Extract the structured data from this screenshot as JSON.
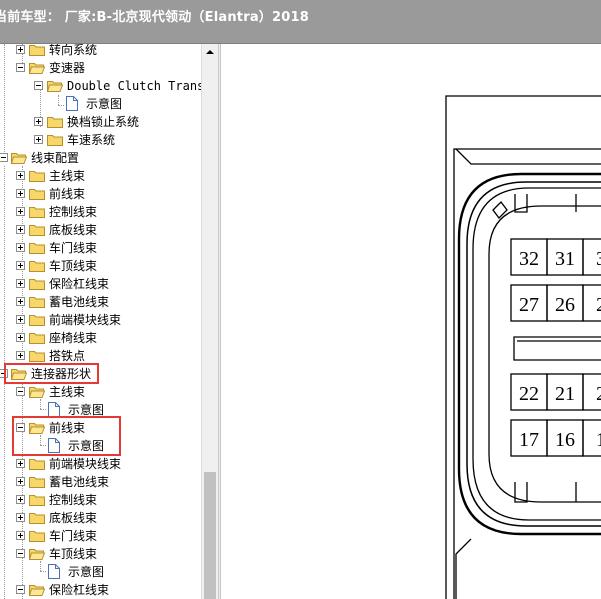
{
  "window": {
    "title": "当前车型：  厂家:B-北京现代领动（Elantra）2018"
  },
  "tree": {
    "items": [
      {
        "label": "转向系统",
        "toggle": "plus",
        "icon": "folder"
      },
      {
        "label": "变速器",
        "toggle": "minus",
        "icon": "folder-open"
      },
      {
        "label": "Double Clutch Transmission",
        "toggle": "minus",
        "icon": "folder-open"
      },
      {
        "label": "示意图",
        "toggle": "",
        "icon": "doc"
      },
      {
        "label": "换档锁止系统",
        "toggle": "plus",
        "icon": "folder"
      },
      {
        "label": "车速系统",
        "toggle": "plus",
        "icon": "folder"
      },
      {
        "label": "线束配置",
        "toggle": "minus",
        "icon": "folder-open"
      },
      {
        "label": "主线束",
        "toggle": "plus",
        "icon": "folder"
      },
      {
        "label": "前线束",
        "toggle": "plus",
        "icon": "folder"
      },
      {
        "label": "控制线束",
        "toggle": "plus",
        "icon": "folder"
      },
      {
        "label": "底板线束",
        "toggle": "plus",
        "icon": "folder"
      },
      {
        "label": "车门线束",
        "toggle": "plus",
        "icon": "folder"
      },
      {
        "label": "车顶线束",
        "toggle": "plus",
        "icon": "folder"
      },
      {
        "label": "保险杠线束",
        "toggle": "plus",
        "icon": "folder"
      },
      {
        "label": "蓄电池线束",
        "toggle": "plus",
        "icon": "folder"
      },
      {
        "label": "前端模块线束",
        "toggle": "plus",
        "icon": "folder"
      },
      {
        "label": "座椅线束",
        "toggle": "plus",
        "icon": "folder"
      },
      {
        "label": "搭铁点",
        "toggle": "plus",
        "icon": "folder"
      },
      {
        "label": "连接器形状",
        "toggle": "minus",
        "icon": "folder-open"
      },
      {
        "label": "主线束",
        "toggle": "minus",
        "icon": "folder-open"
      },
      {
        "label": "示意图",
        "toggle": "",
        "icon": "doc"
      },
      {
        "label": "前线束",
        "toggle": "minus",
        "icon": "folder-open"
      },
      {
        "label": "示意图",
        "toggle": "",
        "icon": "doc"
      },
      {
        "label": "前端模块线束",
        "toggle": "plus",
        "icon": "folder"
      },
      {
        "label": "蓄电池线束",
        "toggle": "plus",
        "icon": "folder"
      },
      {
        "label": "控制线束",
        "toggle": "plus",
        "icon": "folder"
      },
      {
        "label": "底板线束",
        "toggle": "plus",
        "icon": "folder"
      },
      {
        "label": "车门线束",
        "toggle": "plus",
        "icon": "folder"
      },
      {
        "label": "车顶线束",
        "toggle": "minus",
        "icon": "folder-open"
      },
      {
        "label": "示意图",
        "toggle": "",
        "icon": "doc"
      },
      {
        "label": "保险杠线束",
        "toggle": "minus",
        "icon": "folder-open"
      }
    ]
  },
  "connector": {
    "pins_row1": [
      "32",
      "31",
      "3"
    ],
    "pins_row2": [
      "27",
      "26",
      "2"
    ],
    "pins_row3": [
      "22",
      "21",
      "2"
    ],
    "pins_row4": [
      "17",
      "16",
      "1"
    ]
  },
  "colors": {
    "highlight": "#e53935",
    "titlebar": "#9a9a9a",
    "folder": "#f7d66a"
  }
}
